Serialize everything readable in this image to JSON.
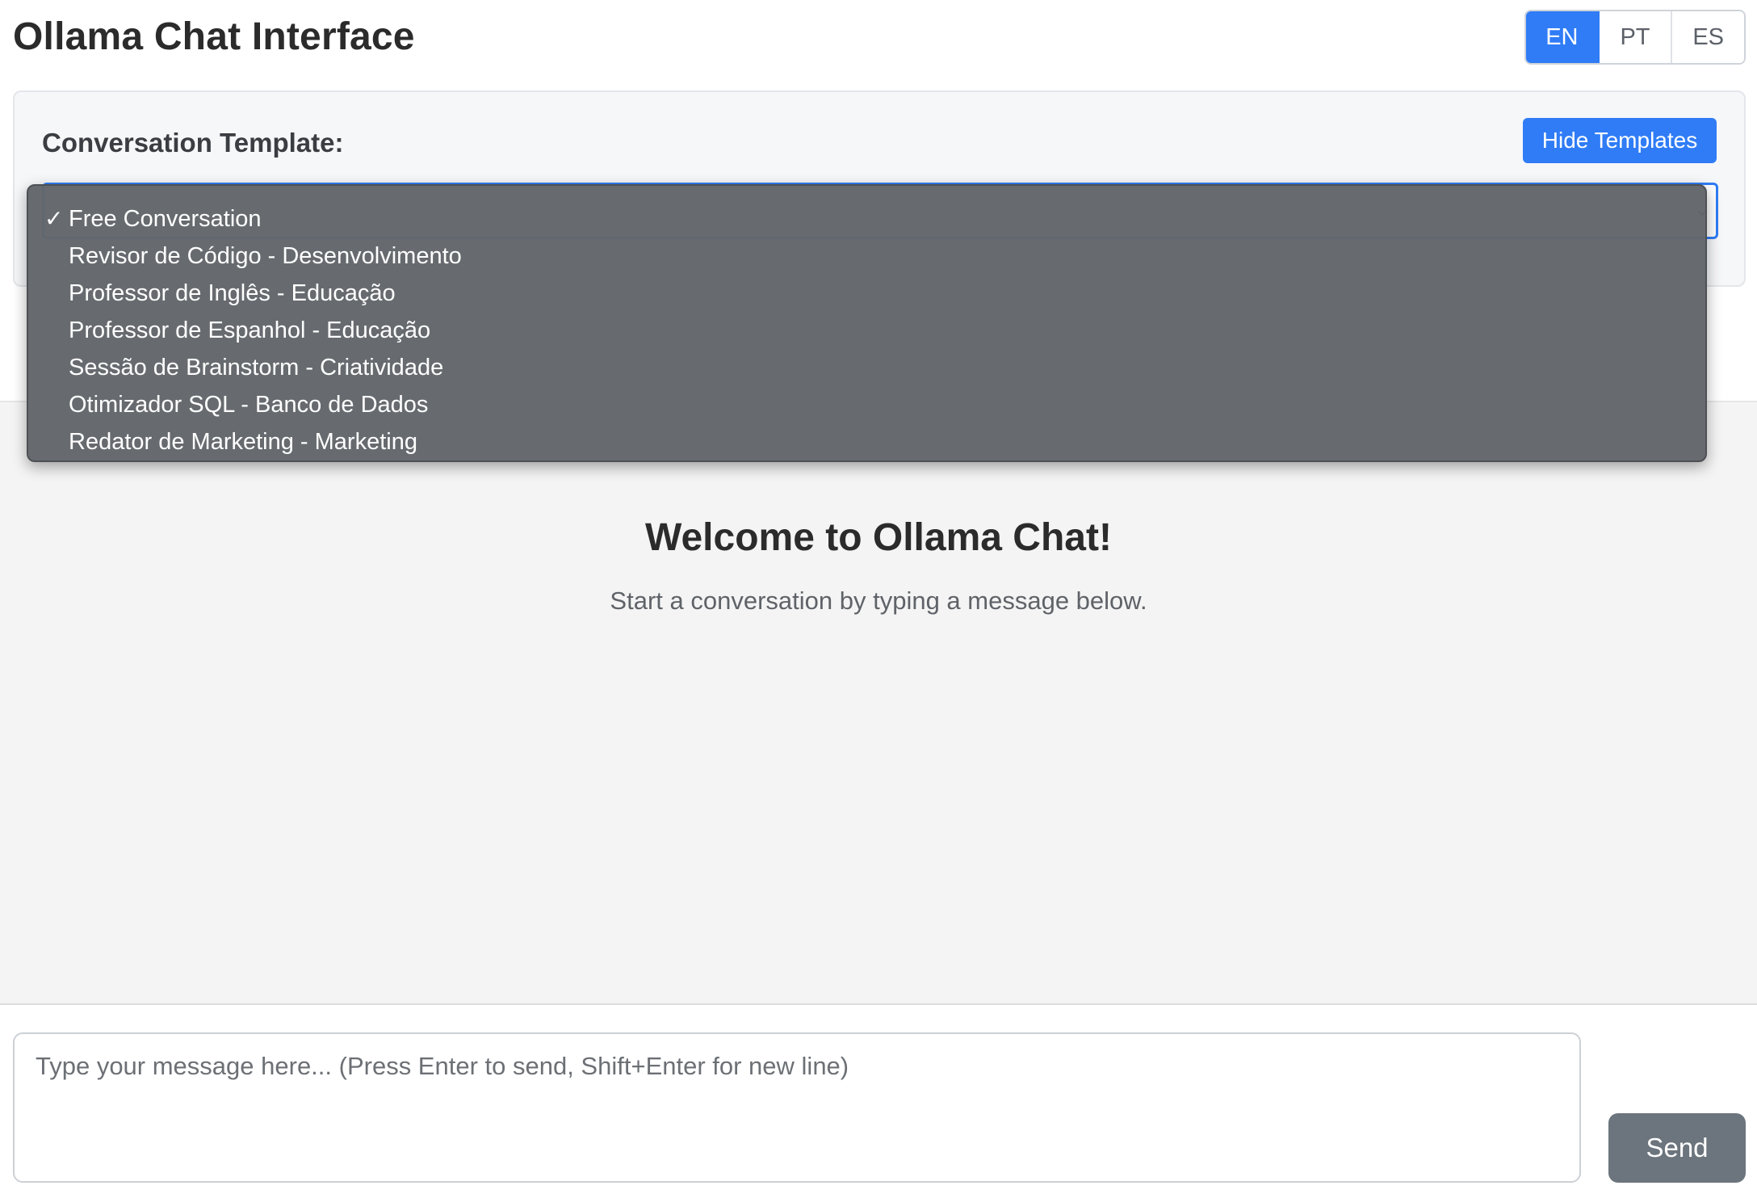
{
  "header": {
    "title": "Ollama Chat Interface",
    "languages": [
      "EN",
      "PT",
      "ES"
    ],
    "active_language": "EN"
  },
  "templates": {
    "label": "Conversation Template:",
    "hide_button": "Hide Templates",
    "selected": "Free Conversation",
    "options": [
      "Free Conversation",
      "Revisor de Código - Desenvolvimento",
      "Professor de Inglês - Educação",
      "Professor de Espanhol - Educação",
      "Sessão de Brainstorm - Criatividade",
      "Otimizador SQL - Banco de Dados",
      "Redator de Marketing - Marketing"
    ],
    "check_mark": "✓"
  },
  "chat": {
    "welcome_title": "Welcome to Ollama Chat!",
    "welcome_subtitle": "Start a conversation by typing a message below."
  },
  "composer": {
    "placeholder": "Type your message here... (Press Enter to send, Shift+Enter for new line)",
    "value": "",
    "send_label": "Send"
  },
  "colors": {
    "accent": "#2f7cf6",
    "send_button": "#6c757d",
    "dropdown_bg": "#62666a"
  }
}
